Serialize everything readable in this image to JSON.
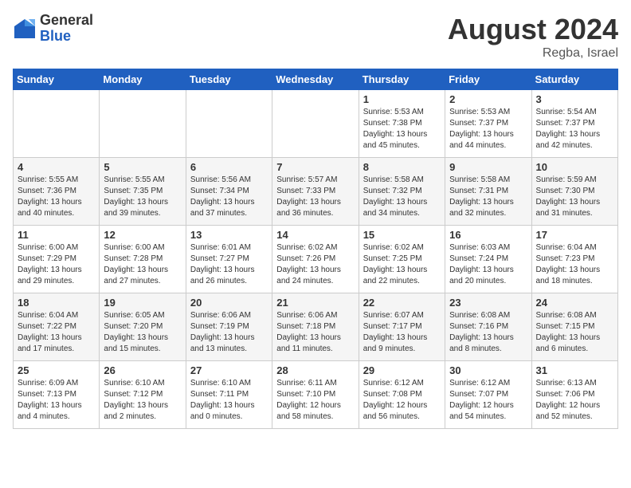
{
  "header": {
    "logo_general": "General",
    "logo_blue": "Blue",
    "month_title": "August 2024",
    "location": "Regba, Israel"
  },
  "days_of_week": [
    "Sunday",
    "Monday",
    "Tuesday",
    "Wednesday",
    "Thursday",
    "Friday",
    "Saturday"
  ],
  "weeks": [
    [
      {
        "day": "",
        "info": ""
      },
      {
        "day": "",
        "info": ""
      },
      {
        "day": "",
        "info": ""
      },
      {
        "day": "",
        "info": ""
      },
      {
        "day": "1",
        "info": "Sunrise: 5:53 AM\nSunset: 7:38 PM\nDaylight: 13 hours\nand 45 minutes."
      },
      {
        "day": "2",
        "info": "Sunrise: 5:53 AM\nSunset: 7:37 PM\nDaylight: 13 hours\nand 44 minutes."
      },
      {
        "day": "3",
        "info": "Sunrise: 5:54 AM\nSunset: 7:37 PM\nDaylight: 13 hours\nand 42 minutes."
      }
    ],
    [
      {
        "day": "4",
        "info": "Sunrise: 5:55 AM\nSunset: 7:36 PM\nDaylight: 13 hours\nand 40 minutes."
      },
      {
        "day": "5",
        "info": "Sunrise: 5:55 AM\nSunset: 7:35 PM\nDaylight: 13 hours\nand 39 minutes."
      },
      {
        "day": "6",
        "info": "Sunrise: 5:56 AM\nSunset: 7:34 PM\nDaylight: 13 hours\nand 37 minutes."
      },
      {
        "day": "7",
        "info": "Sunrise: 5:57 AM\nSunset: 7:33 PM\nDaylight: 13 hours\nand 36 minutes."
      },
      {
        "day": "8",
        "info": "Sunrise: 5:58 AM\nSunset: 7:32 PM\nDaylight: 13 hours\nand 34 minutes."
      },
      {
        "day": "9",
        "info": "Sunrise: 5:58 AM\nSunset: 7:31 PM\nDaylight: 13 hours\nand 32 minutes."
      },
      {
        "day": "10",
        "info": "Sunrise: 5:59 AM\nSunset: 7:30 PM\nDaylight: 13 hours\nand 31 minutes."
      }
    ],
    [
      {
        "day": "11",
        "info": "Sunrise: 6:00 AM\nSunset: 7:29 PM\nDaylight: 13 hours\nand 29 minutes."
      },
      {
        "day": "12",
        "info": "Sunrise: 6:00 AM\nSunset: 7:28 PM\nDaylight: 13 hours\nand 27 minutes."
      },
      {
        "day": "13",
        "info": "Sunrise: 6:01 AM\nSunset: 7:27 PM\nDaylight: 13 hours\nand 26 minutes."
      },
      {
        "day": "14",
        "info": "Sunrise: 6:02 AM\nSunset: 7:26 PM\nDaylight: 13 hours\nand 24 minutes."
      },
      {
        "day": "15",
        "info": "Sunrise: 6:02 AM\nSunset: 7:25 PM\nDaylight: 13 hours\nand 22 minutes."
      },
      {
        "day": "16",
        "info": "Sunrise: 6:03 AM\nSunset: 7:24 PM\nDaylight: 13 hours\nand 20 minutes."
      },
      {
        "day": "17",
        "info": "Sunrise: 6:04 AM\nSunset: 7:23 PM\nDaylight: 13 hours\nand 18 minutes."
      }
    ],
    [
      {
        "day": "18",
        "info": "Sunrise: 6:04 AM\nSunset: 7:22 PM\nDaylight: 13 hours\nand 17 minutes."
      },
      {
        "day": "19",
        "info": "Sunrise: 6:05 AM\nSunset: 7:20 PM\nDaylight: 13 hours\nand 15 minutes."
      },
      {
        "day": "20",
        "info": "Sunrise: 6:06 AM\nSunset: 7:19 PM\nDaylight: 13 hours\nand 13 minutes."
      },
      {
        "day": "21",
        "info": "Sunrise: 6:06 AM\nSunset: 7:18 PM\nDaylight: 13 hours\nand 11 minutes."
      },
      {
        "day": "22",
        "info": "Sunrise: 6:07 AM\nSunset: 7:17 PM\nDaylight: 13 hours\nand 9 minutes."
      },
      {
        "day": "23",
        "info": "Sunrise: 6:08 AM\nSunset: 7:16 PM\nDaylight: 13 hours\nand 8 minutes."
      },
      {
        "day": "24",
        "info": "Sunrise: 6:08 AM\nSunset: 7:15 PM\nDaylight: 13 hours\nand 6 minutes."
      }
    ],
    [
      {
        "day": "25",
        "info": "Sunrise: 6:09 AM\nSunset: 7:13 PM\nDaylight: 13 hours\nand 4 minutes."
      },
      {
        "day": "26",
        "info": "Sunrise: 6:10 AM\nSunset: 7:12 PM\nDaylight: 13 hours\nand 2 minutes."
      },
      {
        "day": "27",
        "info": "Sunrise: 6:10 AM\nSunset: 7:11 PM\nDaylight: 13 hours\nand 0 minutes."
      },
      {
        "day": "28",
        "info": "Sunrise: 6:11 AM\nSunset: 7:10 PM\nDaylight: 12 hours\nand 58 minutes."
      },
      {
        "day": "29",
        "info": "Sunrise: 6:12 AM\nSunset: 7:08 PM\nDaylight: 12 hours\nand 56 minutes."
      },
      {
        "day": "30",
        "info": "Sunrise: 6:12 AM\nSunset: 7:07 PM\nDaylight: 12 hours\nand 54 minutes."
      },
      {
        "day": "31",
        "info": "Sunrise: 6:13 AM\nSunset: 7:06 PM\nDaylight: 12 hours\nand 52 minutes."
      }
    ]
  ]
}
